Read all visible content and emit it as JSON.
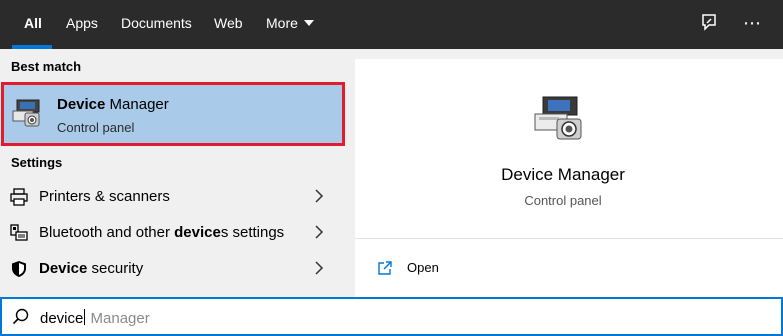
{
  "tabs": [
    {
      "label": "All"
    },
    {
      "label": "Apps"
    },
    {
      "label": "Documents"
    },
    {
      "label": "Web"
    },
    {
      "label": "More"
    }
  ],
  "top_icons": {
    "feedback": "feedback-icon",
    "more": "⋯"
  },
  "best_match": {
    "heading": "Best match",
    "title_bold": "Device",
    "title_rest": " Manager",
    "subtitle": "Control panel",
    "icon": "device-manager-icon"
  },
  "settings": {
    "heading": "Settings",
    "items": [
      {
        "parts": [
          "Printers & scanners"
        ],
        "icon": "printer-icon"
      },
      {
        "parts": [
          "Bluetooth and other ",
          "device",
          "s settings"
        ],
        "icon": "bluetooth-devices-icon"
      },
      {
        "parts": [
          "Device",
          " security"
        ],
        "icon": "shield-icon"
      }
    ]
  },
  "preview": {
    "title": "Device Manager",
    "subtitle": "Control panel",
    "actions": [
      {
        "label": "Open",
        "icon": "open-icon"
      }
    ]
  },
  "search": {
    "typed": "device",
    "suggestion": " Manager"
  },
  "colors": {
    "accent": "#0078d7",
    "selection": "#a9cbe9",
    "highlight_border": "#e41b2d",
    "topbar": "#2b2b2b"
  }
}
